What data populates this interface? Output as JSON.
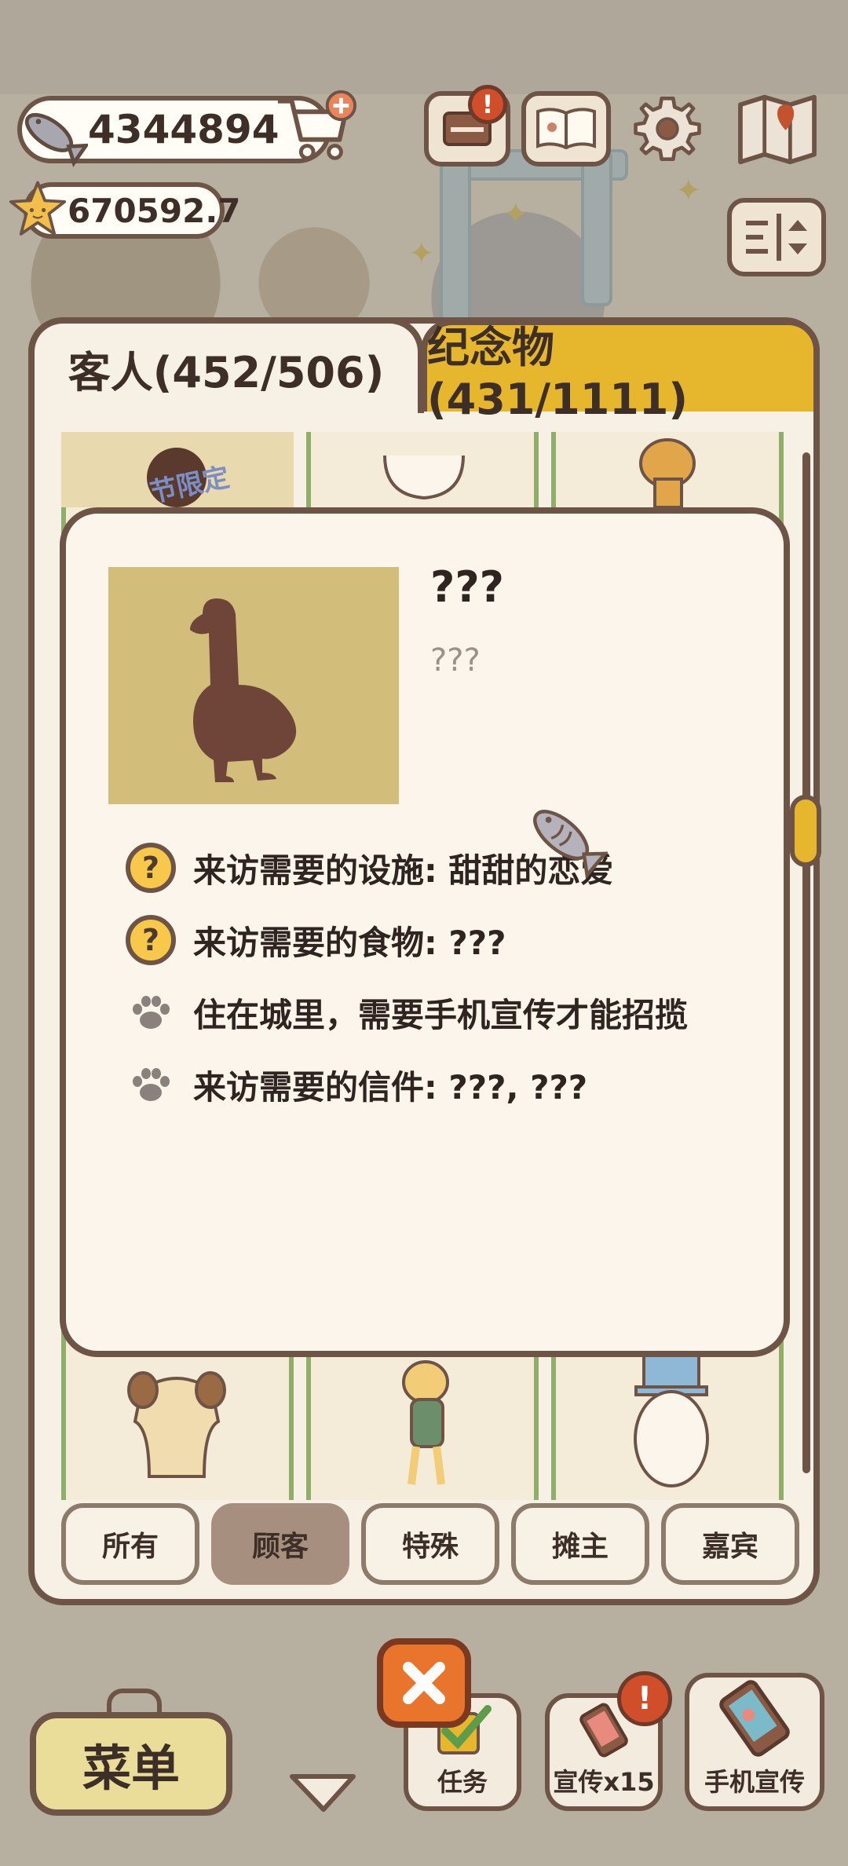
{
  "hud": {
    "fish_count": "4344894",
    "star_count": "670592.7",
    "icons": [
      "fish-icon",
      "star-icon",
      "cart-plus-icon",
      "mailbox-icon",
      "book-icon",
      "gear-icon",
      "map-icon",
      "sliders-icon"
    ],
    "mail_badge": "!"
  },
  "tabs": {
    "guests": "客人(452/506)",
    "souvenirs": "纪念物(431/1111)"
  },
  "grid": {
    "limited_label": "节限定"
  },
  "detail": {
    "name": "???",
    "description": "???",
    "requirements": [
      {
        "icon": "question-icon",
        "text": "来访需要的设施: 甜甜的恋爱"
      },
      {
        "icon": "question-icon",
        "text": "来访需要的食物: ???"
      },
      {
        "icon": "paw-icon",
        "text": "住在城里，需要手机宣传才能招揽"
      },
      {
        "icon": "paw-icon",
        "text": "来访需要的信件: ???, ???"
      }
    ]
  },
  "filters": [
    {
      "label": "所有",
      "active": false
    },
    {
      "label": "顾客",
      "active": true
    },
    {
      "label": "特殊",
      "active": false
    },
    {
      "label": "摊主",
      "active": false
    },
    {
      "label": "嘉宾",
      "active": false
    }
  ],
  "bottom": {
    "menu": "菜单",
    "task": "任务",
    "promo": "宣传x15",
    "phone_promo": "手机宣传",
    "promo_badge": "!"
  },
  "colors": {
    "accent_yellow": "#e6b72c",
    "border_brown": "#6e5446",
    "portrait_bg": "#d2bd7b",
    "close_orange": "#e9742c"
  }
}
